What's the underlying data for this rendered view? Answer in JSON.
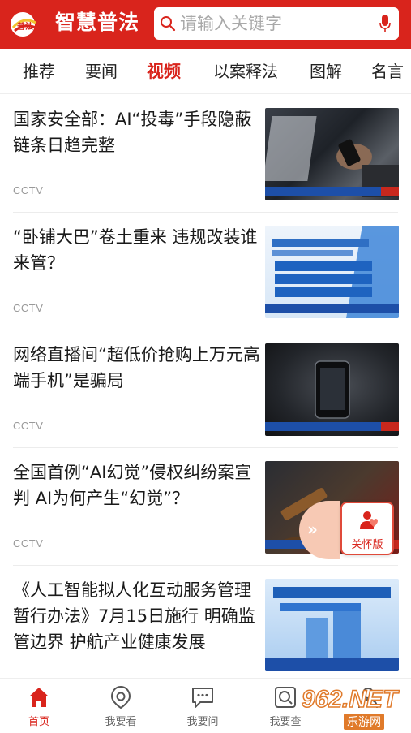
{
  "header": {
    "app_title": "智慧普法",
    "logo_text": "普法",
    "search_placeholder": "请输入关键字",
    "brand_color": "#d9241c"
  },
  "tabs": [
    {
      "label": "推荐",
      "active": false
    },
    {
      "label": "要闻",
      "active": false
    },
    {
      "label": "视频",
      "active": true
    },
    {
      "label": "以案释法",
      "active": false
    },
    {
      "label": "图解",
      "active": false
    },
    {
      "label": "名言",
      "active": false
    }
  ],
  "news": [
    {
      "title": "国家安全部：AI“投毒”手段隐蔽 链条日趋完整",
      "source": "CCTV"
    },
    {
      "title": "“卧铺大巴”卷土重来 违规改装谁来管？",
      "source": "CCTV"
    },
    {
      "title": "网络直播间“超低价抢购上万元高端手机”是骗局",
      "source": "CCTV"
    },
    {
      "title": "全国首例“AI幻觉”侵权纠纷案宣判 AI为何产生“幻觉”？",
      "source": "CCTV"
    },
    {
      "title": "《人工智能拟人化互动服务管理暂行办法》7月15日施行 明确监管边界 护航产业健康发展",
      "source": ""
    }
  ],
  "care_button": {
    "label": "关怀版",
    "arrow": "»",
    "icon": "elder-care-icon"
  },
  "bottom_nav": [
    {
      "label": "首页",
      "icon": "home-icon",
      "active": true
    },
    {
      "label": "我要看",
      "icon": "eye-icon",
      "active": false
    },
    {
      "label": "我要问",
      "icon": "chat-icon",
      "active": false
    },
    {
      "label": "我要查",
      "icon": "search-doc-icon",
      "active": false
    },
    {
      "label": "",
      "icon": "profile-icon",
      "active": false
    }
  ],
  "watermark": {
    "number": "962.NET",
    "sub": "乐游网"
  }
}
